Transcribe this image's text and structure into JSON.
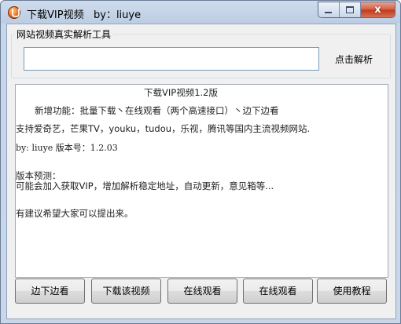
{
  "window": {
    "title": "下载VIP视频",
    "author": "by：liuye",
    "close_symbol": "x"
  },
  "group": {
    "label": "网站视频真实解析工具"
  },
  "url_input": {
    "value": "",
    "placeholder": ""
  },
  "parse_button": "点击解析",
  "notes": {
    "heading": "下载VIP视频1.2版",
    "features": "新增功能：批量下载丶在线观看（两个高速接口）丶边下边看",
    "support": "支持爱奇艺，芒果TV，youku，tudou，乐视，腾讯等国内主流视频网站.",
    "version": "by: liuye 版本号：1.2.03",
    "preview_title": "版本预测：",
    "preview_text": "可能会加入获取VIP，增加解析稳定地址，自动更新，意见箱等...",
    "suggestion": "有建议希望大家可以提出来。"
  },
  "buttons": {
    "watch_while_download": "边下边看",
    "download_video": "下载该视频",
    "online_watch_1": "在线观看",
    "online_watch_2": "在线观看",
    "tutorial": "使用教程"
  },
  "icons": {
    "app": "app-logo-icon",
    "minimize": "minimize-icon",
    "maximize": "maximize-icon",
    "close": "close-icon"
  }
}
